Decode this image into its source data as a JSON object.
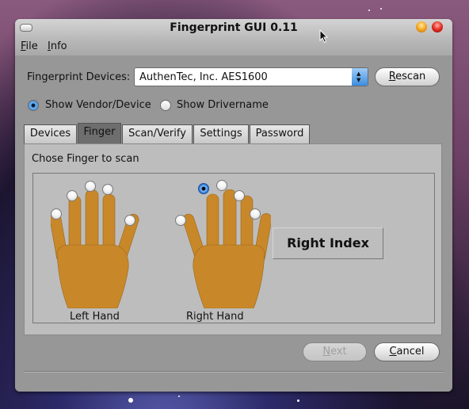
{
  "window": {
    "title": "Fingerprint GUI 0.11"
  },
  "menu": {
    "items": [
      {
        "label": "File",
        "mnemonic": "F",
        "rest": "ile"
      },
      {
        "label": "Info",
        "mnemonic": "I",
        "rest": "nfo"
      }
    ]
  },
  "devices": {
    "label": "Fingerprint Devices:",
    "selected": "AuthenTec, Inc. AES1600",
    "rescan": {
      "mnemonic": "R",
      "rest": "escan",
      "label": "Rescan"
    }
  },
  "display_mode": {
    "options": [
      {
        "label": "Show Vendor/Device",
        "checked": true
      },
      {
        "label": "Show Drivername",
        "checked": false
      }
    ]
  },
  "tabs": [
    {
      "label": "Devices",
      "active": false
    },
    {
      "label": "Finger",
      "active": true
    },
    {
      "label": "Scan/Verify",
      "active": false
    },
    {
      "label": "Settings",
      "active": false
    },
    {
      "label": "Password",
      "active": false
    }
  ],
  "finger_panel": {
    "heading": "Chose Finger to scan",
    "left_hand_label": "Left Hand",
    "right_hand_label": "Right Hand",
    "selected_finger": "Right Index",
    "left_fingers": [
      "Left Little",
      "Left Ring",
      "Left Middle",
      "Left Index",
      "Left Thumb"
    ],
    "right_fingers": [
      "Right Thumb",
      "Right Index",
      "Right Middle",
      "Right Ring",
      "Right Little"
    ],
    "skin_color": "#c8882a"
  },
  "footer": {
    "next": {
      "label": "Next",
      "mnemonic": "N",
      "rest": "ext",
      "enabled": false
    },
    "cancel": {
      "label": "Cancel",
      "mnemonic": "C",
      "rest": "ancel",
      "enabled": true
    }
  }
}
